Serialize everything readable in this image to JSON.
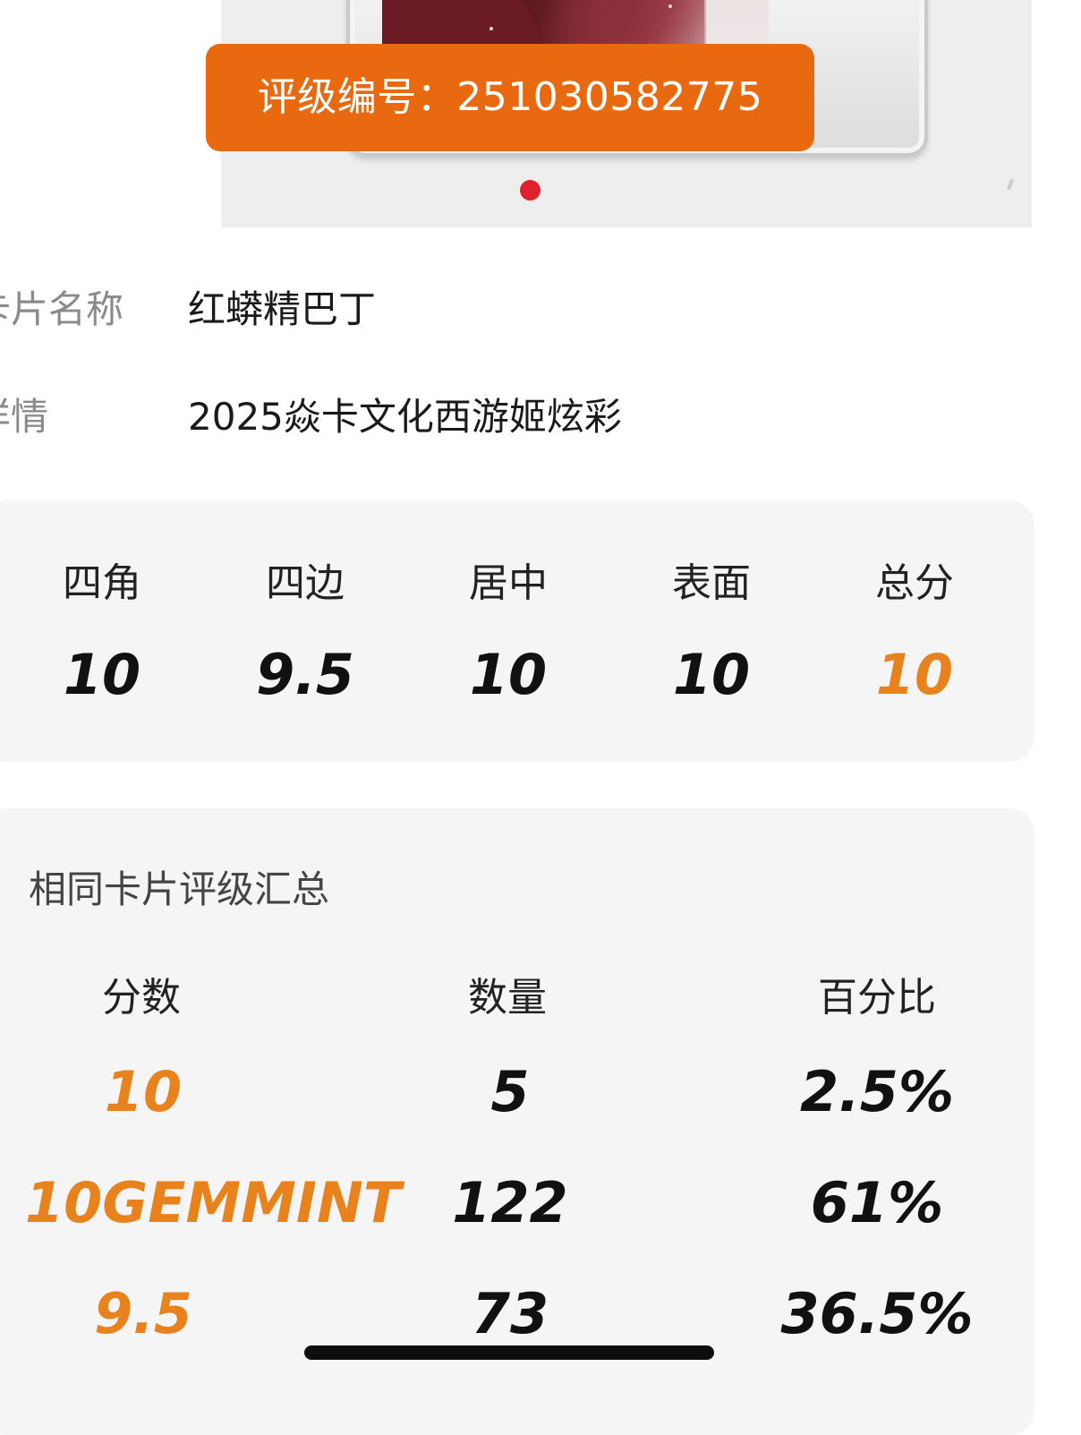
{
  "grade_banner": {
    "label": "评级编号：",
    "number": "251030582775"
  },
  "card_info": {
    "name_label": "卡片名称",
    "name_value": "红蟒精巴丁",
    "detail_label": "详情",
    "detail_value": "2025焱卡文化西游姬炫彩"
  },
  "scores": [
    {
      "label": "四角",
      "value": "10"
    },
    {
      "label": "四边",
      "value": "9.5"
    },
    {
      "label": "居中",
      "value": "10"
    },
    {
      "label": "表面",
      "value": "10"
    },
    {
      "label": "总分",
      "value": "10"
    }
  ],
  "summary": {
    "title": "相同卡片评级汇总",
    "headers": [
      "分数",
      "数量",
      "百分比"
    ],
    "rows": [
      {
        "score": "10",
        "count": "5",
        "percent": "2.5%"
      },
      {
        "score": "10GEMMINT",
        "count": "122",
        "percent": "61%"
      },
      {
        "score": "9.5",
        "count": "73",
        "percent": "36.5%"
      }
    ]
  },
  "colors": {
    "accent": "#e8690f",
    "score_accent": "#e8821c",
    "dot": "#e0202c",
    "card_bg": "#f5f5f5"
  }
}
